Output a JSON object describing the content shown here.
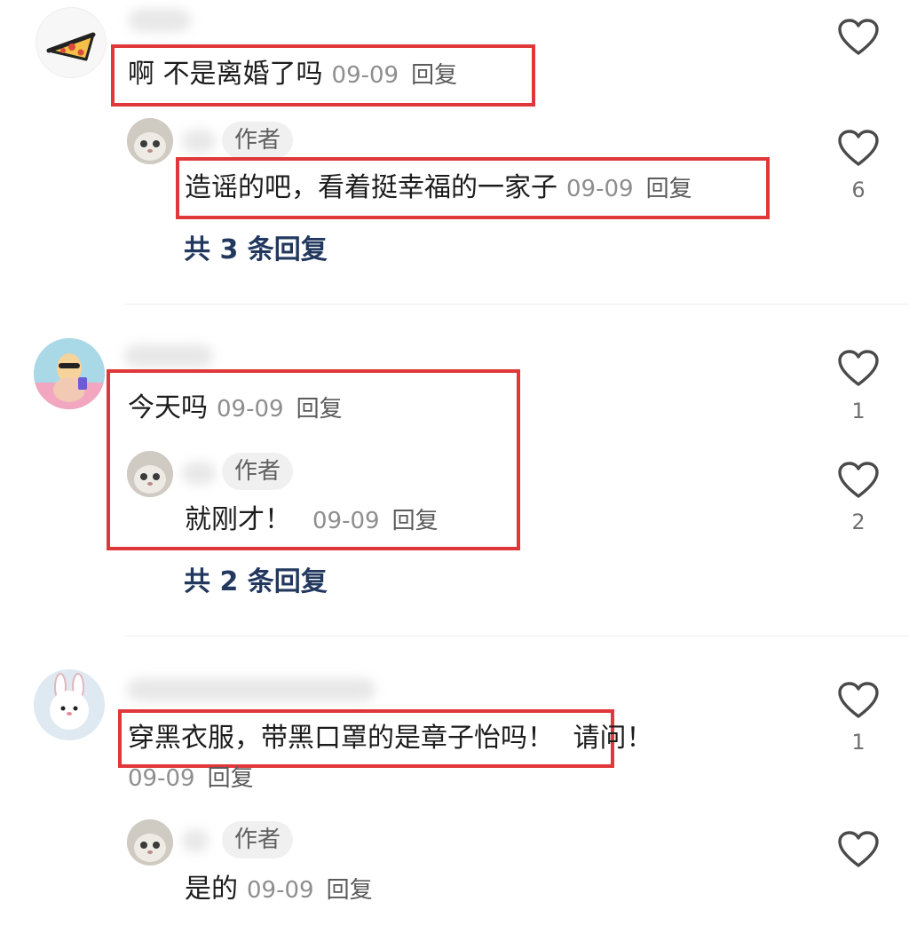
{
  "comments": [
    {
      "text": "啊 不是离婚了吗",
      "date": "09-09",
      "reply_label": "回复",
      "reply": {
        "badge": "作者",
        "text": "造谣的吧，看着挺幸福的一家子",
        "date": "09-09",
        "reply_label": "回复",
        "likes": "6"
      },
      "more_replies": "共 3 条回复"
    },
    {
      "text": "今天吗",
      "date": "09-09",
      "reply_label": "回复",
      "likes": "1",
      "reply": {
        "badge": "作者",
        "text": "就刚才！",
        "date": "09-09",
        "reply_label": "回复",
        "likes": "2"
      },
      "more_replies": "共 2 条回复"
    },
    {
      "text": "穿黑衣服，带黑口罩的是章子怡吗！",
      "text_extra": "请问！",
      "date": "09-09",
      "reply_label": "回复",
      "likes": "1",
      "reply": {
        "badge": "作者",
        "text": "是的",
        "date": "09-09",
        "reply_label": "回复"
      }
    }
  ],
  "colors": {
    "highlight_box": "#e0383a",
    "more_link": "#23385e"
  },
  "icons": {
    "like": "heart-outline-icon"
  }
}
